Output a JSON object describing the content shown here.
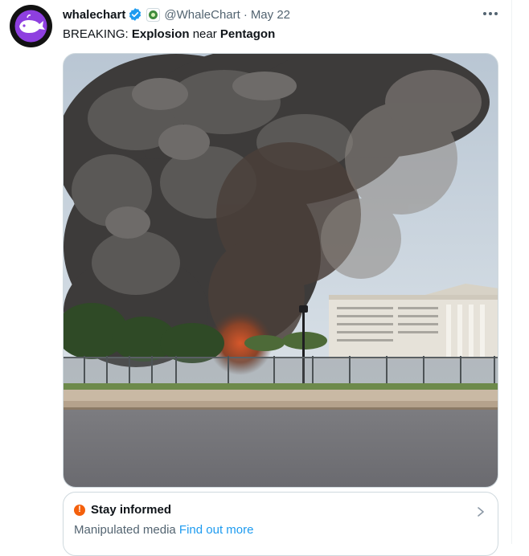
{
  "post": {
    "author_name": "whalechart",
    "handle": "@WhaleChart",
    "separator": "·",
    "date": "May 22",
    "text": {
      "prefix": "BREAKING: ",
      "bold1": "Explosion",
      "middle": " near ",
      "bold2": "Pentagon"
    }
  },
  "notice": {
    "warning_glyph": "!",
    "title": "Stay informed",
    "label": "Manipulated media",
    "link": "Find out more"
  },
  "icons": {
    "verified": "verified-badge-icon",
    "affiliate": "affiliate-badge-icon",
    "more": "more-options-icon",
    "chevron": "chevron-right-icon"
  },
  "colors": {
    "link": "#1d9bf0",
    "verified": "#1d9bf0",
    "warning": "#f4600c",
    "muted_text": "#536471"
  }
}
